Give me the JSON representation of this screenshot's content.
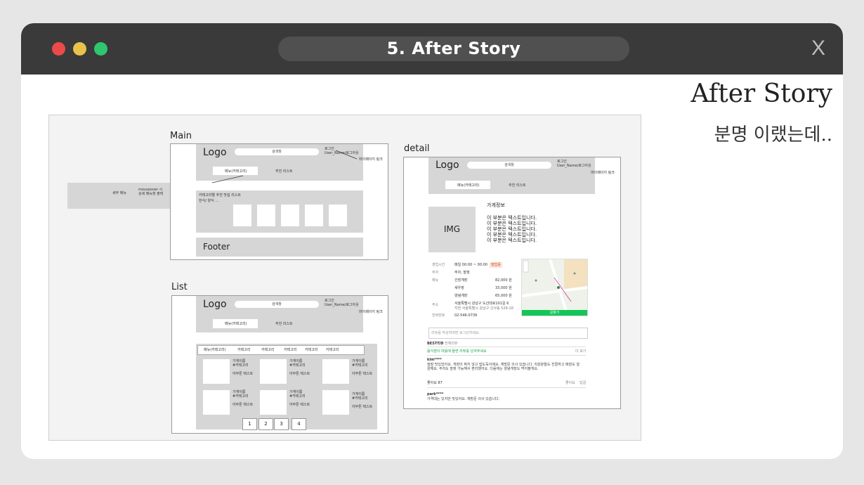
{
  "window": {
    "title": "5. After Story",
    "close_label": "X"
  },
  "heading": "After Story",
  "subheading": "분명 이랬는데..",
  "main": {
    "label": "Main",
    "logo": "Logo",
    "search": "검색창",
    "login": "로그인\nUser_Name/로그아웃",
    "mypage": "마이페이지 링크",
    "menu": "메뉴(카테고리)",
    "recommend": "추천 리스트",
    "side_left": "세부 메뉴",
    "side_right": "mouseover 시\n상세 메뉴창 출력",
    "section_title": "카테고리별 추천 맛집 리스트",
    "section_sub": "한식/ 양식 ...",
    "footer": "Footer"
  },
  "list": {
    "label": "List",
    "logo": "Logo",
    "search": "검색창",
    "login": "로그인\nUser_Name/로그아웃",
    "mypage": "마이페이지 링크",
    "menu": "메뉴(카테고리)",
    "recommend": "추천 리스트",
    "categories": [
      "메뉴(카테고리)",
      "카테고리",
      "카테고리",
      "카테고리",
      "카테고리",
      "카테고리"
    ],
    "items": [
      {
        "name": "가게이름\n#카테고리",
        "text": "아무튼 텍스트"
      },
      {
        "name": "가게이름\n#카테고리",
        "text": "아무튼 텍스트"
      },
      {
        "name": "가게이름\n#카테고리",
        "text": "아무튼 텍스트"
      },
      {
        "name": "가게이름\n#카테고리",
        "text": "아무튼 텍스트"
      },
      {
        "name": "가게이름\n#카테고리",
        "text": "아무튼 텍스트"
      },
      {
        "name": "가게이름\n#카테고리",
        "text": "아무튼 텍스트"
      }
    ],
    "pages": [
      "1",
      "2",
      "3",
      "4"
    ]
  },
  "detail": {
    "label": "detail",
    "logo": "Logo",
    "search": "검색창",
    "login": "로그인\nUser_Name/로그아웃",
    "mypage": "마이페이지 링크",
    "menu": "메뉴(카테고리)",
    "recommend": "추천 리스트",
    "img": "IMG",
    "info_title": "가게정보",
    "info_lines": [
      "이 부분은 텍스트입니다.",
      "이 부분은 텍스트입니다.",
      "이 부분은 텍스트입니다.",
      "이 부분은 텍스트입니다.",
      "이 부분은 텍스트입니다."
    ],
    "hours_label": "영업시간",
    "hours_value": "매일 00:00 ~ 00:00",
    "hours_badge": "영업중",
    "parking_label": "주차",
    "parking_value": "주차, 발렛",
    "menu_label": "메뉴",
    "menu_items": [
      {
        "name": "간장게장",
        "price": "82,000 원"
      },
      {
        "name": "새우장",
        "price": "33,000 원"
      },
      {
        "name": "양념게장",
        "price": "65,000 원"
      }
    ],
    "address_label": "주소",
    "address_value": "서울특별시 강남구 도산대로101길 6",
    "address_sub": "지번 서울특별시 강남구 신사동 529-16",
    "phone_label": "전화번호",
    "phone_value": "02-546-0739",
    "directions": "길찾기",
    "comment_placeholder": "리뷰를 작성하려면 로그인하세요.",
    "best_review": "BEST리뷰",
    "all_reviews": "전체리뷰",
    "review_hint": "음식점이 마음에 들면 리뷰를 남겨주세요",
    "review_write": "더 보기",
    "review1_name": "kim****",
    "review1_text": "정말 맛있었어요. 게장이 짜지 않고 밥도둑이에요. 재방문 의사 있습니다. 직원분들도 친절하고 매장도 깔끔해요. 주차도 발렛 가능해서 편리했어요. 다음에는 양념게장도 먹어볼게요.",
    "review1_more": "좋아요 87",
    "review1_like": "좋아요",
    "review1_reply": "답글",
    "review2_name": "park****",
    "review2_text": "가격대는 있지만 맛있어요. 재방문 의사 있습니다."
  }
}
